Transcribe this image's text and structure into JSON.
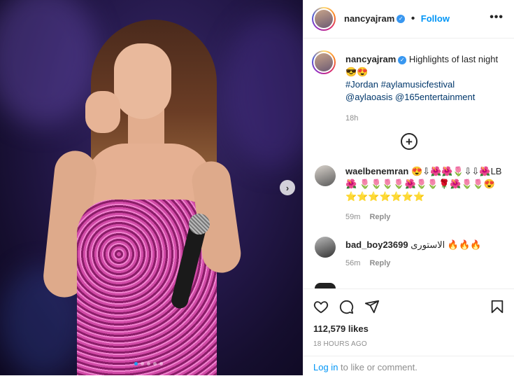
{
  "post": {
    "username": "nancyajram",
    "follow_label": "Follow",
    "more_label": "•••",
    "carousel_next": "›"
  },
  "caption": {
    "username": "nancyajram",
    "text_line1": "Highlights of last night",
    "emoji_line": "😎😍",
    "hashtags": "#Jordan #aylamusicfestival",
    "mentions": "@aylaoasis @165entertainment",
    "time": "18h"
  },
  "add_comment_symbol": "+",
  "comments": [
    {
      "username": "waelbenemran",
      "text": "😍⇩🌺🌺🌷⇩⇩🌺LB🌺 🌷🌷🌷🌷🌺🌷🌷🌹🌺🌷🌷😍 ⭐⭐⭐⭐⭐⭐⭐",
      "time": "59m",
      "reply": "Reply"
    },
    {
      "username": "bad_boy23699",
      "text": "الاستورى 🔥🔥🔥",
      "time": "56m",
      "reply": "Reply"
    }
  ],
  "likes": "112,579 likes",
  "posted_ago": "18 HOURS AGO",
  "login": {
    "link": "Log in",
    "rest": " to like or comment."
  },
  "icons": {
    "like": "heart-icon",
    "comment": "comment-icon",
    "share": "share-icon",
    "save": "bookmark-icon",
    "verified": "verified-badge-icon",
    "add": "add-comment-icon"
  }
}
